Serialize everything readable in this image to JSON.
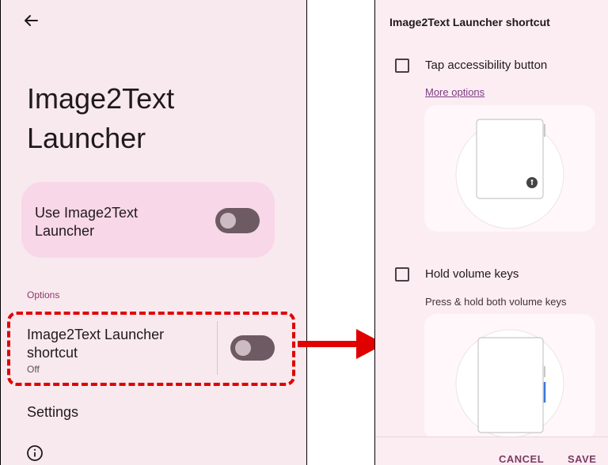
{
  "left_screen": {
    "title": "Image2Text Launcher",
    "main_toggle": {
      "label": "Use Image2Text Launcher",
      "on": false
    },
    "section_label": "Options",
    "shortcut_row": {
      "title": "Image2Text Launcher shortcut",
      "summary": "Off",
      "on": false
    },
    "settings_label": "Settings",
    "icons": {
      "back": "back-arrow-icon",
      "info": "info-icon"
    }
  },
  "right_screen": {
    "dialog_title": "Image2Text Launcher shortcut",
    "options": [
      {
        "label": "Tap accessibility button",
        "checked": false,
        "link": "More options"
      },
      {
        "label": "Hold volume keys",
        "checked": false,
        "description": "Press & hold both volume keys"
      }
    ],
    "buttons": {
      "cancel": "CANCEL",
      "save": "SAVE"
    }
  },
  "annotation": {
    "highlight_color": "#e00000",
    "arrow_color": "#e00000"
  },
  "colors": {
    "accent": "#7b3b63",
    "card": "#f8d7e8",
    "background": "#f8e9ee"
  }
}
